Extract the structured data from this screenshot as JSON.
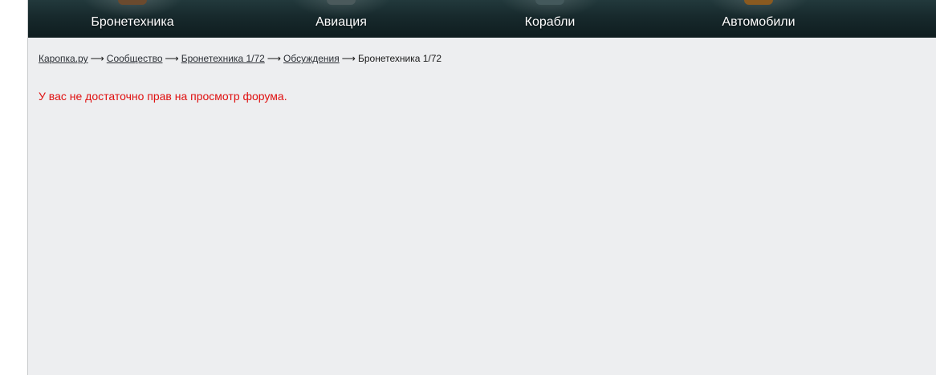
{
  "nav": {
    "items": [
      {
        "label": "Бронетехника",
        "thumb_color": "#6b4a2e"
      },
      {
        "label": "Авиация",
        "thumb_color": "#4b5a5c"
      },
      {
        "label": "Корабли",
        "thumb_color": "#44595c"
      },
      {
        "label": "Автомобили",
        "thumb_color": "#8a5a20"
      }
    ]
  },
  "breadcrumb": {
    "separator": "⟶",
    "links": [
      "Каропка.ру",
      "Сообщество",
      "Бронетехника 1/72",
      "Обсуждения"
    ],
    "current": "Бронетехника 1/72"
  },
  "message": {
    "text": "У вас не достаточно прав на просмотр форума.",
    "color": "#e01010"
  }
}
